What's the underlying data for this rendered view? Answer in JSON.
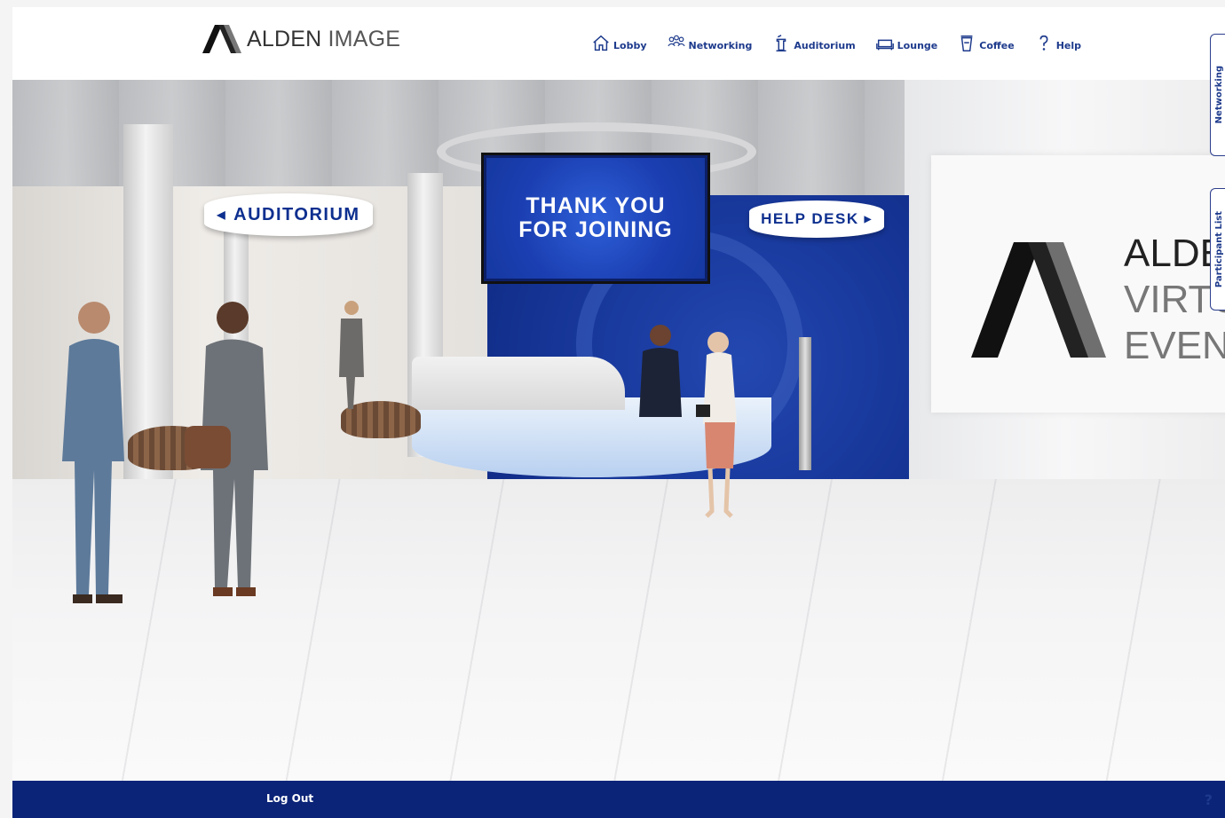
{
  "brand": {
    "name_bold": "ALDEN",
    "name_light": "IMAGE"
  },
  "nav": [
    {
      "label": "Lobby",
      "icon": "home-icon"
    },
    {
      "label": "Networking",
      "icon": "people-icon"
    },
    {
      "label": "Auditorium",
      "icon": "podium-icon"
    },
    {
      "label": "Lounge",
      "icon": "sofa-icon"
    },
    {
      "label": "Coffee",
      "icon": "coffee-cup-icon"
    },
    {
      "label": "Help",
      "icon": "question-icon"
    }
  ],
  "side_tabs": {
    "networking": "Networking",
    "participants": "Participant List"
  },
  "scene": {
    "auditorium_sign": "AUDITORIUM",
    "help_desk_sign": "HELP DESK",
    "screen_line1": "THANK YOU",
    "screen_line2": "FOR JOINING",
    "wall_logo_line1": "ALDE",
    "wall_logo_line2": "VIRTU",
    "wall_logo_line3": "EVENT"
  },
  "footer": {
    "logout": "Log Out"
  },
  "colors": {
    "brand_blue": "#0b2478",
    "nav_blue": "#1d3a8c"
  }
}
